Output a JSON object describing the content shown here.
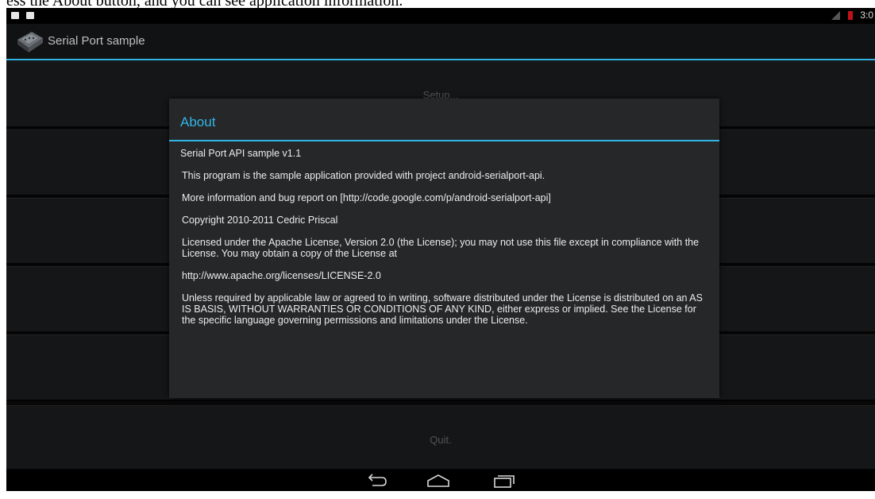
{
  "caption": "ess the About button, and you can see application information.",
  "status_bar": {
    "time": "3:0",
    "icons": [
      "notification-icon",
      "android-notification-icon",
      "signal-icon",
      "battery-icon"
    ]
  },
  "action_bar": {
    "title": "Serial Port sample",
    "icon": "serial-port-app-icon"
  },
  "buttons": {
    "setup": "Setup...",
    "quit": "Quit."
  },
  "dialog": {
    "title": "About",
    "paragraphs": [
      "Serial Port API sample v1.1",
      "This program is the sample application provided with project android-serialport-api.",
      "More information and bug report on [http://code.google.com/p/android-serialport-api]",
      "Copyright 2010-2011 Cedric Priscal",
      "Licensed under the Apache License, Version 2.0 (the License); you may not use this file except in compliance with the License. You may obtain a copy of the License at",
      "http://www.apache.org/licenses/LICENSE-2.0",
      "Unless required by applicable law or agreed to in writing, software distributed under the License is distributed on an AS IS BASIS, WITHOUT WARRANTIES OR CONDITIONS OF ANY KIND, either express or implied. See the License for the specific language governing permissions and limitations under the License."
    ]
  },
  "nav_bar": {
    "icons": [
      "back-icon",
      "home-icon",
      "recent-apps-icon"
    ]
  },
  "colors": {
    "accent": "#33b5e5",
    "background": "#0b0b0b",
    "dialog": "#262729"
  }
}
